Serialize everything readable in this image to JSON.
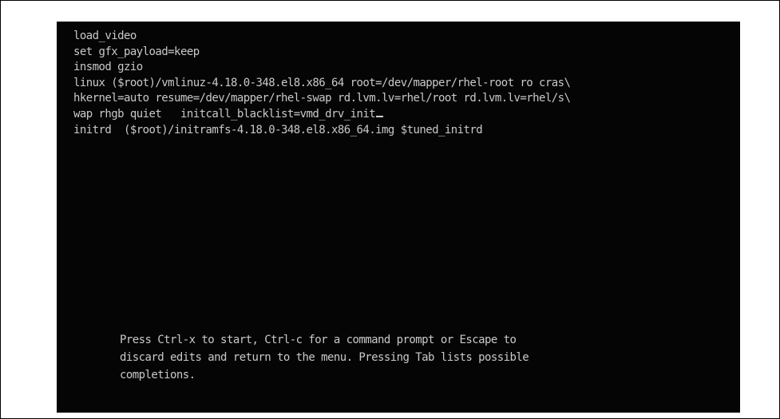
{
  "editor": {
    "lines": [
      "load_video",
      "set gfx_payload=keep",
      "insmod gzio",
      "linux ($root)/vmlinuz-4.18.0-348.el8.x86_64 root=/dev/mapper/rhel-root ro cras\\",
      "hkernel=auto resume=/dev/mapper/rhel-swap rd.lvm.lv=rhel/root rd.lvm.lv=rhel/s\\",
      "wap rhgb quiet   initcall_blacklist=vmd_drv_init",
      "initrd  ($root)/initramfs-4.18.0-348.el8.x86_64.img $tuned_initrd"
    ]
  },
  "help": {
    "lines": [
      "Press Ctrl-x to start, Ctrl-c for a command prompt or Escape to",
      "discard edits and return to the menu. Pressing Tab lists possible",
      "completions."
    ]
  },
  "colors": {
    "background": "#050505",
    "text": "#c9c9c9",
    "page": "#ffffff"
  }
}
